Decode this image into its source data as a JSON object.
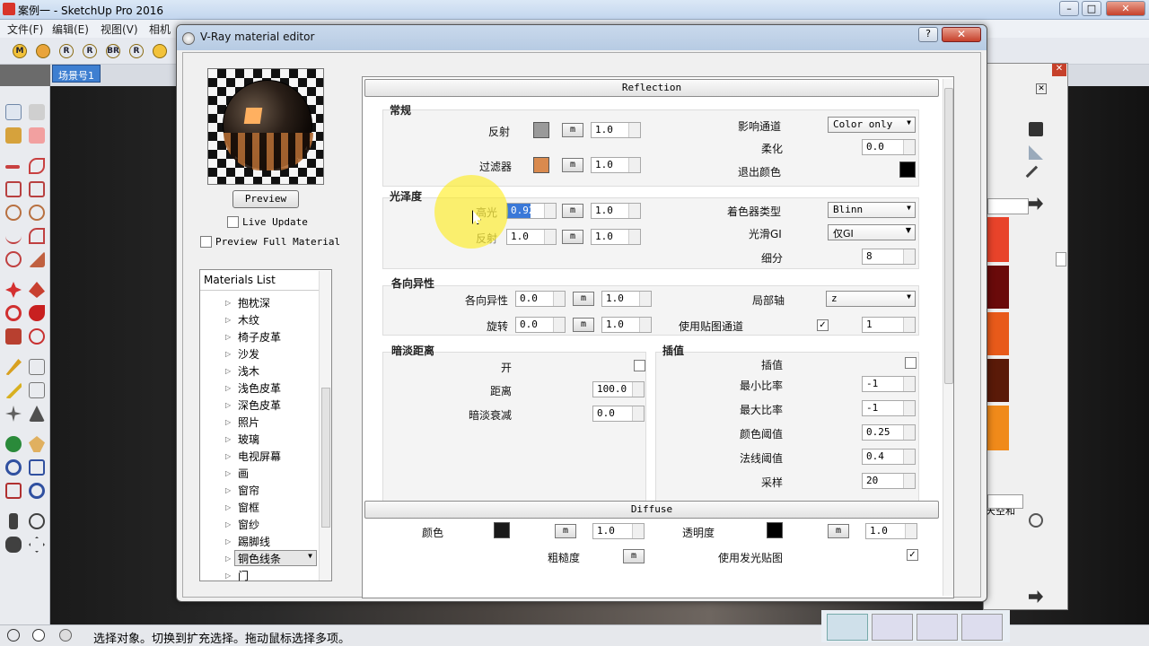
{
  "app": {
    "title": "案例一 - SketchUp Pro 2016",
    "status_text": "选择对象。切换到扩充选择。拖动鼠标选择多项。",
    "window_controls": [
      "–",
      "□",
      "✕"
    ]
  },
  "menu": [
    "文件(F)",
    "编辑(E)",
    "视图(V)",
    "相机"
  ],
  "toolbar_icons": [
    "M",
    "R",
    "R",
    "BR",
    "R"
  ],
  "scene_tab": "场景号1",
  "dialog": {
    "title": "V-Ray material editor",
    "help_label": "?",
    "close_label": "✕",
    "preview_button": "Preview",
    "live_update_label": "Live Update",
    "preview_full_label": "Preview Full Material",
    "materials_header": "Materials List",
    "materials": [
      "抱枕深",
      "木纹",
      "椅子皮革",
      "沙发",
      "浅木",
      "浅色皮革",
      "深色皮革",
      "照片",
      "玻璃",
      "电视屏幕",
      "画",
      "窗帘",
      "窗框",
      "窗纱",
      "踢脚线",
      "铜色线条",
      "门"
    ],
    "selected_material": "铜色线条"
  },
  "reflection": {
    "section_title": "Reflection",
    "general_title": "常规",
    "reflect_label": "反射",
    "reflect_value": "1.0",
    "reflect_color": "#9a9a9a",
    "filter_label": "过滤器",
    "filter_value": "1.0",
    "filter_color": "#d98a4e",
    "affect_channels_label": "影响通道",
    "affect_channels_value": "Color only",
    "soften_label": "柔化",
    "soften_value": "0.0",
    "exit_color_label": "退出颜色",
    "exit_color": "#000000",
    "gloss_title": "光泽度",
    "highlight_label": "高光",
    "highlight_value": "0.92",
    "highlight_mult": "1.0",
    "gloss_reflect_label": "反射",
    "gloss_reflect_value": "1.0",
    "gloss_reflect_mult": "1.0",
    "brdf_label": "着色器类型",
    "brdf_value": "Blinn",
    "smooth_gi_label": "光滑GI",
    "smooth_gi_value": "仅GI",
    "subdivs_label": "细分",
    "subdivs_value": "8",
    "anis_title": "各向异性",
    "anis_label": "各向异性",
    "anis_value": "0.0",
    "anis_mult": "1.0",
    "rotation_label": "旋转",
    "rotation_value": "0.0",
    "rotation_mult": "1.0",
    "local_axis_label": "局部轴",
    "local_axis_value": "z",
    "use_map_channel_label": "使用贴图通道",
    "use_map_channel_checked": "✓",
    "map_channel_value": "1",
    "dim_title": "暗淡距离",
    "dim_on_label": "开",
    "dim_dist_label": "距离",
    "dim_dist_value": "100.0",
    "dim_falloff_label": "暗淡衰减",
    "dim_falloff_value": "0.0",
    "interp_title": "插值",
    "interp_label": "插值",
    "min_rate_label": "最小比率",
    "min_rate_value": "-1",
    "max_rate_label": "最大比率",
    "max_rate_value": "-1",
    "clr_thresh_label": "颜色阈值",
    "clr_thresh_value": "0.25",
    "nrm_thresh_label": "法线阈值",
    "nrm_thresh_value": "0.4",
    "samples_label": "采样",
    "samples_value": "20",
    "m": "m"
  },
  "diffuse": {
    "section_title": "Diffuse",
    "color_label": "颜色",
    "color": "#1a1a1a",
    "color_mult": "1.0",
    "transp_label": "透明度",
    "transp_color": "#000000",
    "transp_mult": "1.0",
    "roughness_label": "粗糙度",
    "use_emit_label": "使用发光贴图",
    "use_emit_checked": "✓"
  },
  "tray": {
    "text": "天空和",
    "swatches": [
      "#e8432a",
      "#6a0a0a",
      "#e85a1a",
      "#5a1a08",
      "#f08a1a",
      "#a0520f"
    ]
  }
}
